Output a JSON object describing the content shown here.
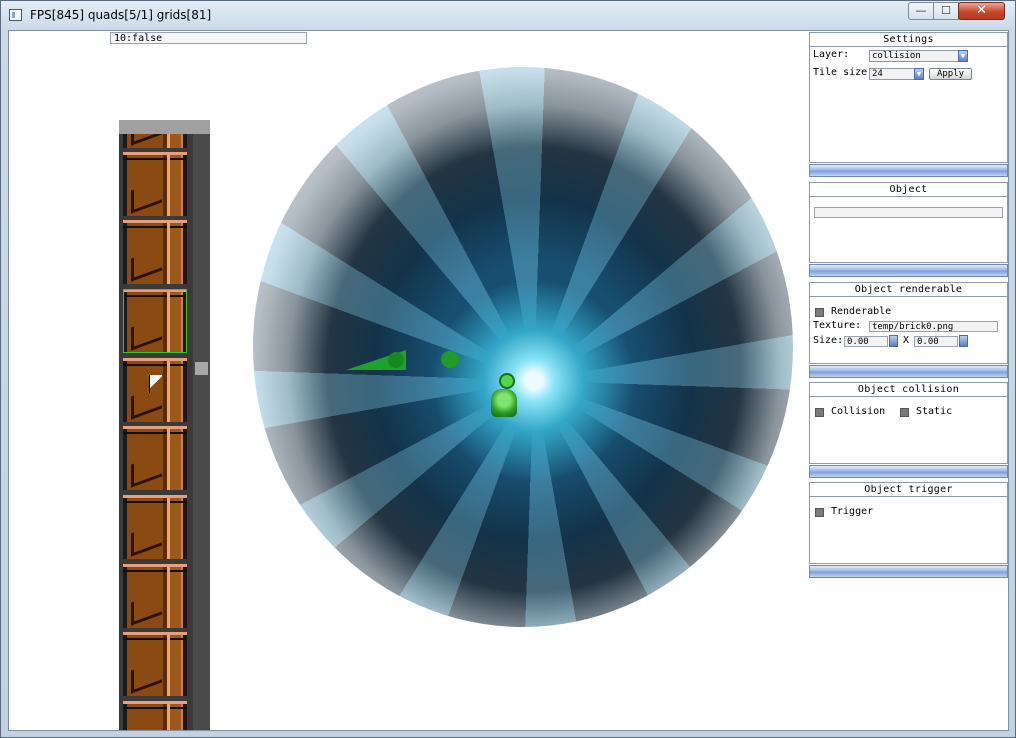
{
  "window": {
    "title": "FPS[845] quads[5/1] grids[81]",
    "min_glyph": "—",
    "max_glyph": "☐",
    "close_glyph": "✕"
  },
  "console": {
    "value": "10:false"
  },
  "palette": {
    "tile_count": 9,
    "selected_index": 2
  },
  "panels": {
    "settings": {
      "title": "Settings",
      "layer_label": "Layer:",
      "layer_value": "collision",
      "tile_size_label": "Tile size:",
      "tile_size_value": "24",
      "apply_label": "Apply"
    },
    "object": {
      "title": "Object",
      "value": ""
    },
    "renderable": {
      "title": "Object renderable",
      "renderable_label": "Renderable",
      "texture_label": "Texture:",
      "texture_value": "temp/brick0.png",
      "size_label": "Size:",
      "size_x": "0.00",
      "size_sep": "X",
      "size_y": "0.00"
    },
    "collision": {
      "title": "Object collision",
      "collision_label": "Collision",
      "static_label": "Static"
    },
    "trigger": {
      "title": "Object trigger",
      "trigger_label": "Trigger"
    }
  },
  "icons": {
    "app": "app-icon",
    "combo_arrow": "chevron-down-icon",
    "spin": "spin-arrows-icon"
  },
  "colors": {
    "panel_footer": "#7e9fd9",
    "green_shape": "#1fa82c",
    "selected_tile": "#34c834"
  }
}
